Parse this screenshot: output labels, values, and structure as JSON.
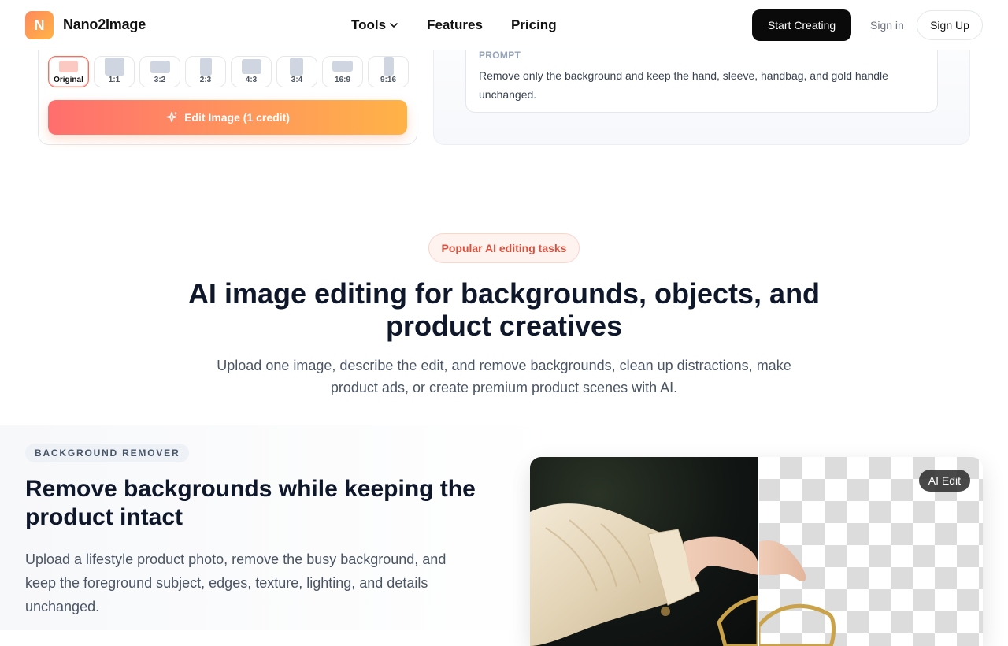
{
  "nav": {
    "logo_letter": "N",
    "brand": "Nano2Image",
    "links": [
      {
        "label": "Tools",
        "has_dropdown": true
      },
      {
        "label": "Features"
      },
      {
        "label": "Pricing"
      }
    ],
    "start_label": "Start Creating",
    "signin_label": "Sign in",
    "signup_label": "Sign Up"
  },
  "editor": {
    "ratios": [
      {
        "label": "Original",
        "selected": true
      },
      {
        "label": "1:1"
      },
      {
        "label": "3:2"
      },
      {
        "label": "2:3"
      },
      {
        "label": "4:3"
      },
      {
        "label": "3:4"
      },
      {
        "label": "16:9"
      },
      {
        "label": "9:16"
      }
    ],
    "edit_button_label": "Edit Image (1 credit)",
    "prompt_label": "PROMPT",
    "prompt_text": "Remove only the background and keep the hand, sleeve, handbag, and gold handle unchanged."
  },
  "section": {
    "pill": "Popular AI editing tasks",
    "heading": "AI image editing for backgrounds, objects, and product creatives",
    "subheading": "Upload one image, describe the edit, and remove backgrounds, clean up distractions, make product ads, or create premium product scenes with AI."
  },
  "feature": {
    "tag": "BACKGROUND REMOVER",
    "title": "Remove backgrounds while keeping the product intact",
    "description": "Upload a lifestyle product photo, remove the busy background, and keep the foreground subject, edges, texture, lighting, and details unchanged.",
    "badge": "AI Edit"
  },
  "colors": {
    "accent_gradient_start": "#ff6e6e",
    "accent_gradient_end": "#ffb347",
    "pill_text": "#d9503f",
    "dark_button": "#0a0a0a"
  }
}
